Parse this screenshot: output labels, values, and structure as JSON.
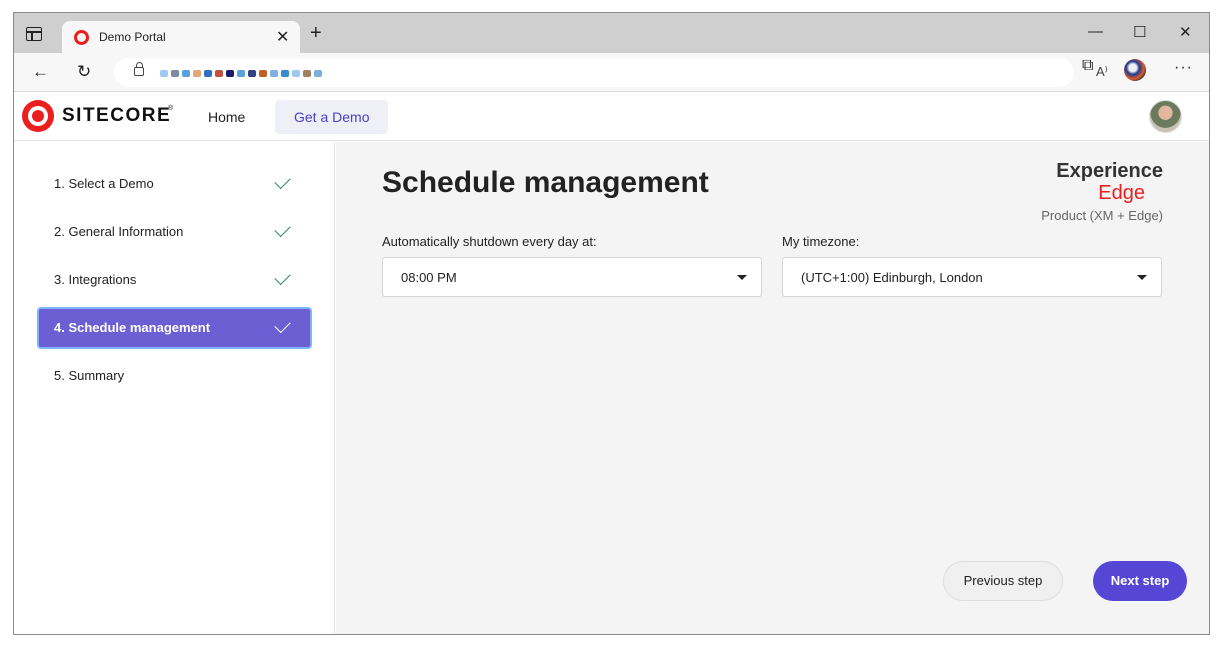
{
  "browser": {
    "tab_title": "Demo Portal",
    "tab_close": "✕",
    "new_tab": "+",
    "minimize": "—",
    "maximize": "☐",
    "close": "✕",
    "read_aloud": "A⁾",
    "back_icon": "←",
    "refresh_icon": "↻",
    "favorites_icon": "☆",
    "collections_icon": "⧉",
    "more_icon": "···"
  },
  "header": {
    "logo_text": "SITECORE",
    "logo_tm": "®",
    "nav": [
      {
        "label": "Home"
      },
      {
        "label": "Get a Demo"
      }
    ]
  },
  "steps": [
    {
      "label": "1. Select a Demo",
      "done": true
    },
    {
      "label": "2. General Information",
      "done": true
    },
    {
      "label": "3. Integrations",
      "done": true
    },
    {
      "label": "4. Schedule management",
      "done": true,
      "active": true
    },
    {
      "label": "5. Summary",
      "done": false
    }
  ],
  "main": {
    "title": "Schedule management",
    "product": {
      "line1": "Experience",
      "line2": "Edge",
      "line3": "Product (XM + Edge)"
    },
    "shutdown": {
      "label": "Automatically shutdown every day at:",
      "value": "08:00 PM"
    },
    "timezone": {
      "label": "My timezone:",
      "value": "(UTC+1:00) Edinburgh, London"
    },
    "buttons": {
      "previous": "Previous step",
      "next": "Next step"
    }
  },
  "colors": {
    "brand_red": "#eb1f1f",
    "accent_purple": "#5546d6",
    "active_step": "#6b5fd3",
    "check_green": "#2e8b57"
  }
}
